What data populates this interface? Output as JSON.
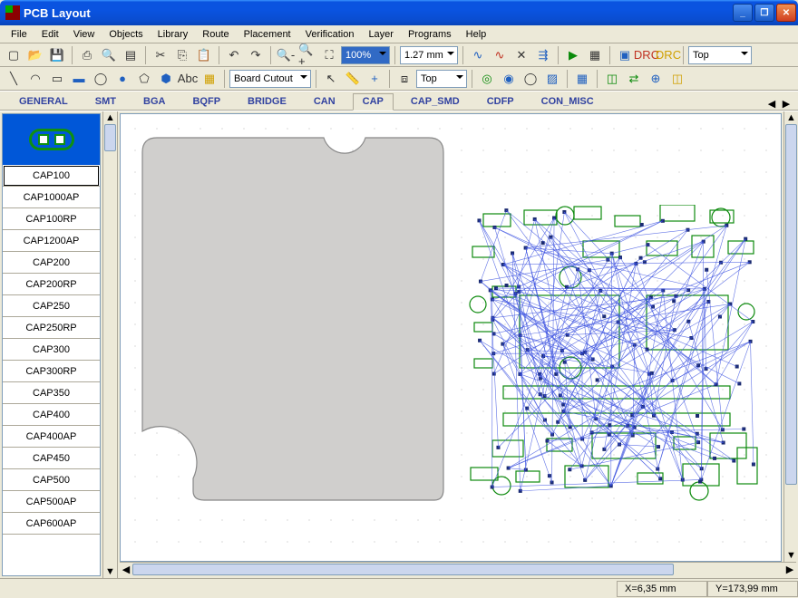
{
  "title": "PCB Layout",
  "menu": [
    "File",
    "Edit",
    "View",
    "Objects",
    "Library",
    "Route",
    "Placement",
    "Verification",
    "Layer",
    "Programs",
    "Help"
  ],
  "toolbar1": {
    "zoom_value": "100%",
    "grid_value": "1.27 mm",
    "layer_value": "Top"
  },
  "toolbar2": {
    "obj_layer_combo": "Board Cutout",
    "layer2_value": "Top"
  },
  "tabs": [
    "GENERAL",
    "SMT",
    "BGA",
    "BQFP",
    "BRIDGE",
    "CAN",
    "CAP",
    "CAP_SMD",
    "CDFP",
    "CON_MISC"
  ],
  "active_tab": "CAP",
  "components": [
    "CAP100",
    "CAP1000AP",
    "CAP100RP",
    "CAP1200AP",
    "CAP200",
    "CAP200RP",
    "CAP250",
    "CAP250RP",
    "CAP300",
    "CAP300RP",
    "CAP350",
    "CAP400",
    "CAP400AP",
    "CAP450",
    "CAP500",
    "CAP500AP",
    "CAP600AP"
  ],
  "selected_component": "CAP100",
  "status": {
    "x": "X=6,35 mm",
    "y": "Y=173,99 mm"
  },
  "winbtns": {
    "min": "_",
    "max": "❐",
    "close": "✕"
  }
}
